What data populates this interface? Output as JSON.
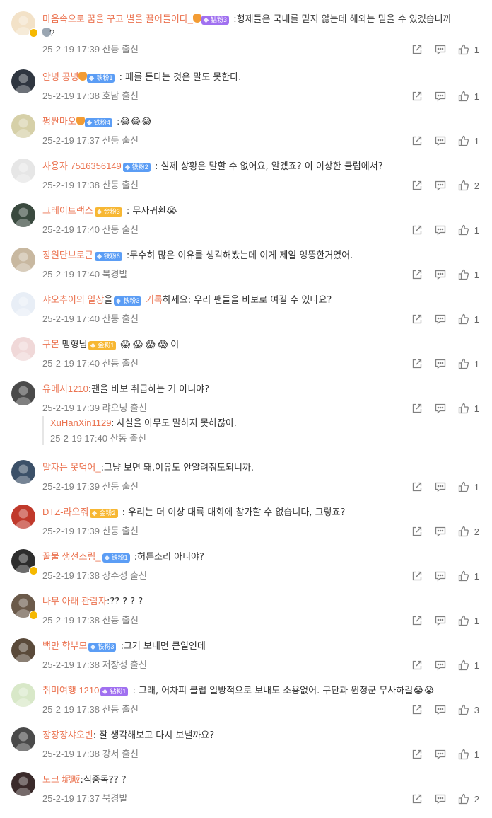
{
  "comments": [
    {
      "user": "마음속으로 꿈을 꾸고 별을 끌어들이다_",
      "fan": "钻粉3",
      "fan_color": "purple",
      "crown": true,
      "text": " :형제들은 국내를 믿지 않는데 해외는 믿을 수 있겠습니까",
      "text2": "?",
      "meta": "25-2-19 17:39 산둥 출신",
      "likes": "1",
      "avatar_color": "#f3e2c8",
      "avatar_icon": "cat-avatar",
      "verified": true
    },
    {
      "user": "안녕 공녕",
      "fan": "铁粉1",
      "fan_color": "blue",
      "crown": true,
      "text": " : 패를 든다는 것은 말도 못한다.",
      "meta": "25-2-19 17:38 호남 출신",
      "likes": "1",
      "avatar_color": "#2f3640",
      "avatar_icon": "person-avatar",
      "verified": false
    },
    {
      "user": "펑싼마오",
      "fan": "铁粉4",
      "fan_color": "blue",
      "crown": true,
      "text": " :😂😂😂",
      "meta": "25-2-19 17:37 산둥 출신",
      "likes": "1",
      "avatar_color": "#d6d0a8",
      "avatar_icon": "cartoon-avatar",
      "verified": false
    },
    {
      "user": "사용자 7516356149",
      "fan": "铁粉2",
      "fan_color": "blue",
      "crown": false,
      "text": " : 실제 상황은 말할 수 없어요, 알겠죠? 이 이상한 클럽에서?",
      "meta": "25-2-19 17:38 산동 출신",
      "likes": "2",
      "avatar_color": "#e6e6e6",
      "avatar_icon": "default-avatar",
      "verified": false
    },
    {
      "user": "그레이트랙스",
      "fan": "金粉3",
      "fan_color": "gold",
      "crown": false,
      "text": " : 무사귀환😭",
      "meta": "25-2-19 17:40 산동 출신",
      "likes": "1",
      "avatar_color": "#3a4a3f",
      "avatar_icon": "person-avatar",
      "verified": false
    },
    {
      "user": "장원단브로큰",
      "fan": "铁粉6",
      "fan_color": "blue",
      "crown": false,
      "text": " :무수히 많은 이유를 생각해봤는데 이게 제일 엉뚱한거였어.",
      "meta": "25-2-19 17:40 북경발",
      "likes": "1",
      "avatar_color": "#c8b8a0",
      "avatar_icon": "person-avatar",
      "verified": false
    },
    {
      "user": "샤오추이의 일상",
      "user_suffix": "을",
      "fan": "铁粉3",
      "fan_color": "blue",
      "crown": false,
      "user2": " 기록",
      "text": "하세요: 우리 팬들을 바보로 여길 수 있나요?",
      "meta": "25-2-19 17:40 산동 출신",
      "likes": "1",
      "avatar_color": "#e8eef6",
      "avatar_icon": "emblem-avatar",
      "verified": false
    },
    {
      "user": "구몬",
      "user_suffix": " 맹형님",
      "fan": "金粉1",
      "fan_color": "gold",
      "crown": false,
      "text": " 😱 😱 😱 😱 이",
      "meta": "25-2-19 17:40 산동 출신",
      "likes": "1",
      "avatar_color": "#f0d8d8",
      "avatar_icon": "jersey-avatar",
      "verified": false
    },
    {
      "user": "유메시1210",
      "fan": "",
      "fan_color": "",
      "crown": false,
      "text": ":팬을 바보 취급하는 거 아니야?",
      "meta": "25-2-19 17:39 랴오닝 출신",
      "likes": "1",
      "avatar_color": "#4a4a4a",
      "avatar_icon": "person-avatar",
      "verified": false
    },
    {
      "user": "말자는 못먹어_",
      "fan": "",
      "fan_color": "",
      "crown": false,
      "text": ":그냥 보면 돼.이유도 안알려줘도되니까.",
      "meta": "25-2-19 17:39 산동 출신",
      "likes": "1",
      "avatar_color": "#3b5068",
      "avatar_icon": "person-avatar",
      "verified": false
    },
    {
      "user": "DTZ-라오줘",
      "fan": "金粉2",
      "fan_color": "gold",
      "crown": false,
      "text": " : 우리는 더 이상 대륙 대회에 참가할 수 없습니다, 그렇죠?",
      "meta": "25-2-19 17:39 산동 출신",
      "likes": "2",
      "avatar_color": "#c0392b",
      "avatar_icon": "logo-avatar",
      "verified": false
    },
    {
      "user": "꿀물 생선조림_",
      "fan": "铁粉1",
      "fan_color": "blue",
      "crown": false,
      "text": " :허튼소리 아니야?",
      "meta": "25-2-19 17:38 장수성 출신",
      "likes": "1",
      "avatar_color": "#2d2d2d",
      "avatar_icon": "person-avatar",
      "verified": true
    },
    {
      "user": "나무 아래 관람자",
      "fan": "",
      "fan_color": "",
      "crown": false,
      "text": ":?? ? ? ?",
      "meta": "25-2-19 17:38 산동 출신",
      "likes": "1",
      "avatar_color": "#6b5a4a",
      "avatar_icon": "person-avatar",
      "verified": true
    },
    {
      "user": "백만 학부모",
      "fan": "铁粉3",
      "fan_color": "blue",
      "crown": false,
      "text": " :그거 보내면 큰일인데",
      "meta": "25-2-19 17:38 저장성 출신",
      "likes": "1",
      "avatar_color": "#5a4a3a",
      "avatar_icon": "person-avatar",
      "verified": false
    },
    {
      "user": "취미여행 1210",
      "fan": "钻粉1",
      "fan_color": "purple",
      "crown": false,
      "text": " : 그래, 어차피 클럽 일방적으로 보내도 소용없어. 구단과 원정군 무사하길😭😭",
      "meta": "25-2-19 17:38 산동 출신",
      "likes": "3",
      "avatar_color": "#d8e8c8",
      "avatar_icon": "travel-avatar",
      "verified": false
    },
    {
      "user": "장장장샤오빈",
      "fan": "",
      "fan_color": "",
      "crown": false,
      "text": ": 잘 생각해보고 다시 보낼까요?",
      "meta": "25-2-19 17:38 강서 출신",
      "likes": "1",
      "avatar_color": "#4a4a4a",
      "avatar_icon": "person-avatar",
      "verified": false
    },
    {
      "user": "도크 坭畈",
      "fan": "",
      "fan_color": "",
      "crown": false,
      "text": ":식중독?? ?",
      "meta": "25-2-19 17:37 북경발",
      "likes": "2",
      "avatar_color": "#3a2a2a",
      "avatar_icon": "person-avatar",
      "verified": false
    }
  ],
  "reply": {
    "user": "XuHanXin1129",
    "text": ": 사실을 아무도 말하지 못하잖아.",
    "meta": "25-2-19 17:40 산동 출신"
  },
  "icons": {
    "share": "share-icon",
    "comment": "comment-icon",
    "like": "like-icon"
  }
}
